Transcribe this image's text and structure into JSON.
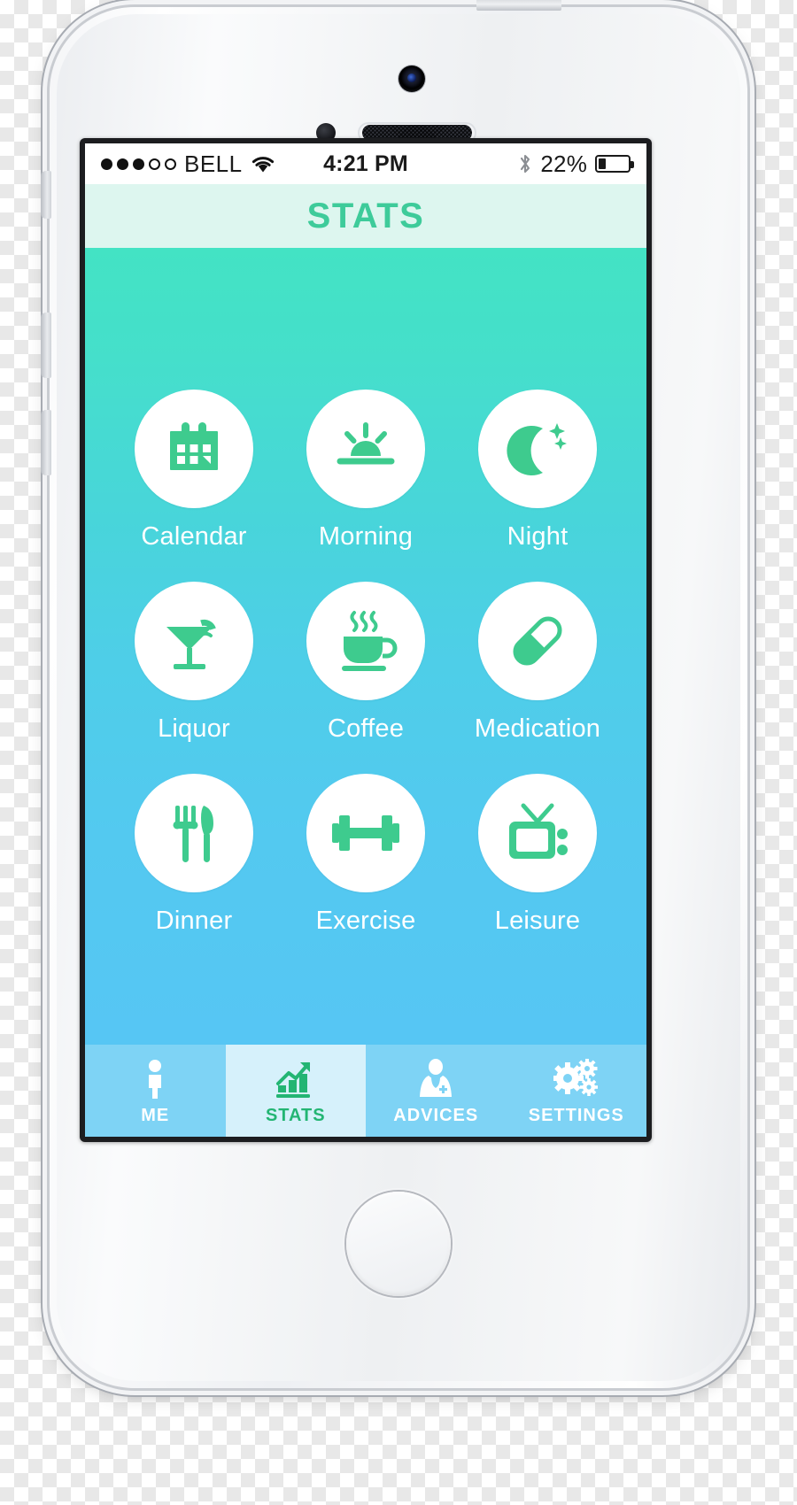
{
  "device": {
    "name": "iphone-5s-white",
    "elements": [
      "camera",
      "proximity-sensor",
      "earpiece-speaker",
      "home-button",
      "power-button",
      "mute-switch",
      "volume-up",
      "volume-down"
    ]
  },
  "statusbar": {
    "signal_dots_total": 5,
    "signal_dots_filled": 3,
    "carrier": "BELL",
    "wifi_icon": "wifi-icon",
    "time": "4:21 PM",
    "bluetooth_icon": "bluetooth-icon",
    "battery_percent": "22%",
    "battery_level": 22
  },
  "navbar": {
    "title": "STATS",
    "title_color": "#3ecb9a",
    "background": "#ddf6ef"
  },
  "content": {
    "gradient_from": "#43e3c4",
    "gradient_to": "#56c6f4",
    "icon_color": "#3ecb8e",
    "circle_color": "#ffffff",
    "label_color": "#ffffff",
    "rows": [
      [
        {
          "label": "Calendar",
          "icon": "calendar-icon"
        },
        {
          "label": "Morning",
          "icon": "sunrise-icon"
        },
        {
          "label": "Night",
          "icon": "moon-stars-icon"
        }
      ],
      [
        {
          "label": "Liquor",
          "icon": "cocktail-icon"
        },
        {
          "label": "Coffee",
          "icon": "coffee-cup-icon"
        },
        {
          "label": "Medication",
          "icon": "pill-capsule-icon"
        }
      ],
      [
        {
          "label": "Dinner",
          "icon": "fork-knife-icon"
        },
        {
          "label": "Exercise",
          "icon": "dumbbell-icon"
        },
        {
          "label": "Leisure",
          "icon": "television-icon"
        }
      ]
    ]
  },
  "tabbar": {
    "background": "#7ed3f5",
    "active_background": "#d6f1fb",
    "active_color": "#23b573",
    "inactive_color": "#ffffff",
    "tabs": [
      {
        "label": "ME",
        "icon": "person-icon",
        "active": false
      },
      {
        "label": "STATS",
        "icon": "bar-chart-arrow-icon",
        "active": true
      },
      {
        "label": "ADVICES",
        "icon": "doctor-icon",
        "active": false
      },
      {
        "label": "SETTINGS",
        "icon": "gears-icon",
        "active": false
      }
    ]
  }
}
